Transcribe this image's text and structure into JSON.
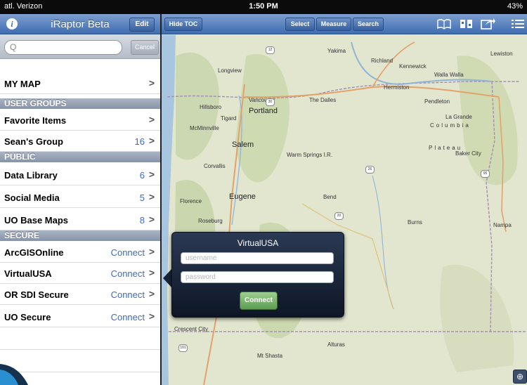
{
  "status_bar": {
    "carrier": "atl. Verizon",
    "time": "1:50 PM",
    "battery": "43%"
  },
  "sidebar": {
    "title": "iRaptor Beta",
    "edit_label": "Edit",
    "search": {
      "placeholder": "Q",
      "cancel_label": "Cancel"
    },
    "my_map": {
      "label": "MY MAP"
    },
    "sections": {
      "user_groups": "USER GROUPS",
      "public": "PUBLIC",
      "secure": "SECURE"
    },
    "user_groups": [
      {
        "label": "Favorite Items",
        "count": ""
      },
      {
        "label": "Sean's Group",
        "count": "16"
      }
    ],
    "public": [
      {
        "label": "Data Library",
        "count": "6"
      },
      {
        "label": "Social Media",
        "count": "5"
      },
      {
        "label": "UO Base Maps",
        "count": "8"
      }
    ],
    "secure": [
      {
        "label": "ArcGISOnline",
        "action": "Connect"
      },
      {
        "label": "VirtualUSA",
        "action": "Connect"
      },
      {
        "label": "OR SDI Secure",
        "action": "Connect"
      },
      {
        "label": "UO Secure",
        "action": "Connect"
      }
    ]
  },
  "toolbar": {
    "hide_toc": "Hide TOC",
    "select": "Select",
    "measure": "Measure",
    "search": "Search",
    "icons": [
      "book-icon",
      "layers-map-icon",
      "share-icon",
      "list-icon"
    ]
  },
  "map": {
    "labels": {
      "portland": "Portland",
      "vancouver": "Vancouver",
      "salem": "Salem",
      "eugene": "Eugene",
      "bend": "Bend",
      "richland": "Richland",
      "kennewick": "Kennewick",
      "walla_walla": "Walla Walla",
      "yakima": "Yakima",
      "hillsboro": "Hillsboro",
      "tigard": "Tigard",
      "mcminnville": "McMinnville",
      "corvallis": "Corvallis",
      "longview": "Longview",
      "pendleton": "Pendleton",
      "la_grande": "La Grande",
      "baker_city": "Baker City",
      "burns": "Burns",
      "nampa": "Nampa",
      "lewiston": "Lewiston",
      "columbia": "Columbia",
      "plateau": "Plateau",
      "the_dalles": "The Dalles",
      "hermiston": "Hermiston",
      "florence": "Florence",
      "roseburg": "Roseburg",
      "crescent_city": "Crescent City",
      "mt_shasta": "Mt Shasta",
      "alturas": "Alturas",
      "warm_springs": "Warm Springs I.R."
    }
  },
  "popover": {
    "title": "VirtualUSA",
    "username_placeholder": "username",
    "password_placeholder": "password",
    "connect_label": "Connect"
  }
}
